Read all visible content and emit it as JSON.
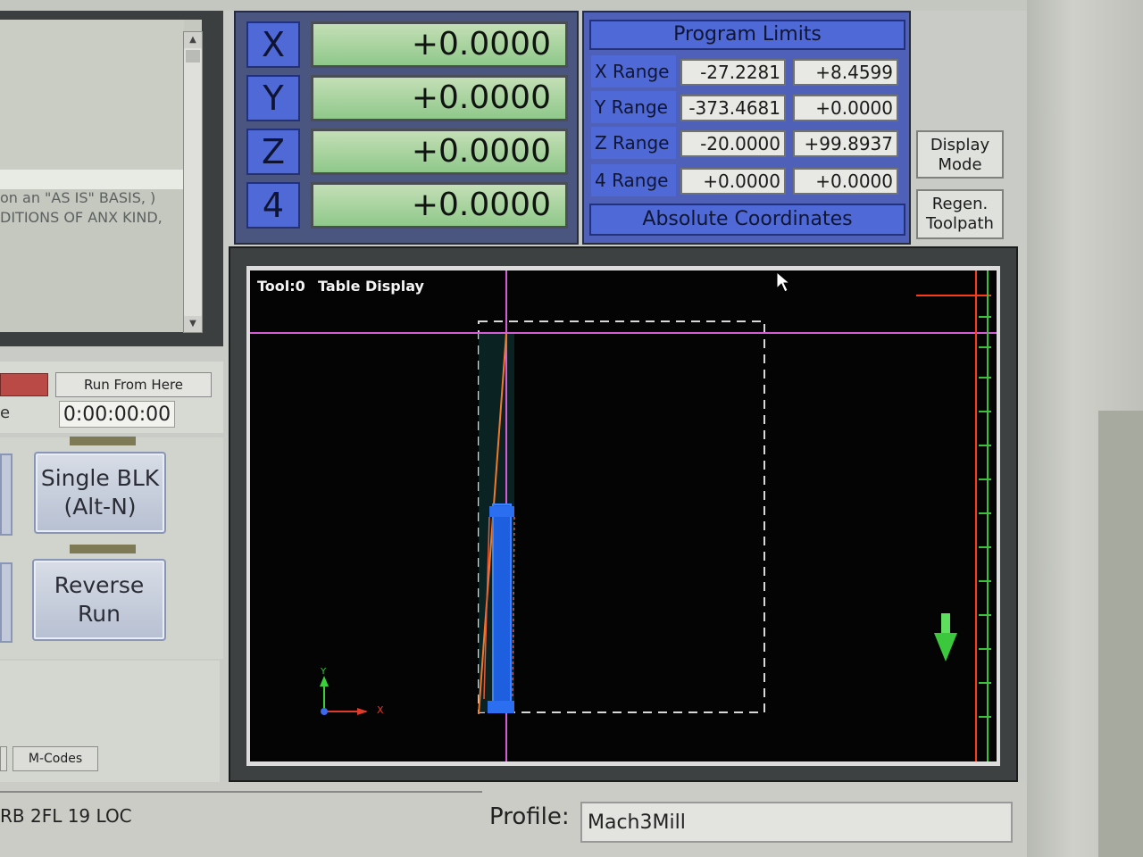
{
  "code_panel": {
    "lines": [
      "on an \"AS IS\" BASIS, )",
      "DITIONS OF ANX KIND,"
    ],
    "scroll_up": "▲",
    "scroll_down": "▼"
  },
  "run_controls": {
    "run_from_here": "Run From Here",
    "time_prefix": "e",
    "elapsed_time": "0:00:00:00",
    "single_block": "Single BLK\n(Alt-N)",
    "reverse_run": "Reverse\nRun",
    "mcodes": "M-Codes"
  },
  "dro": {
    "axes": [
      {
        "label": "X",
        "value": "+0.0000"
      },
      {
        "label": "Y",
        "value": "+0.0000"
      },
      {
        "label": "Z",
        "value": "+0.0000"
      },
      {
        "label": "4",
        "value": "+0.0000"
      }
    ]
  },
  "program_limits": {
    "title": "Program Limits",
    "rows": [
      {
        "label": "X Range",
        "min": "-27.2281",
        "max": "+8.4599"
      },
      {
        "label": "Y Range",
        "min": "-373.4681",
        "max": "+0.0000"
      },
      {
        "label": "Z Range",
        "min": "-20.0000",
        "max": "+99.8937"
      },
      {
        "label": "4 Range",
        "min": "+0.0000",
        "max": "+0.0000"
      }
    ],
    "footer": "Absolute Coordinates"
  },
  "side_buttons": {
    "display_mode": "Display\nMode",
    "regen_toolpath": "Regen.\nToolpath"
  },
  "toolpath": {
    "tool": "Tool:0",
    "title": "Table Display",
    "axis_y": "Y",
    "axis_x": "X"
  },
  "status": {
    "left_text": "RB 2FL 19 LOC",
    "profile_label": "Profile:",
    "profile_value": "Mach3Mill"
  },
  "colors": {
    "dro_axis_blue": "#4f69d6",
    "dro_value_green": "#a8d39c",
    "toolpath_bg": "#040404",
    "led_red": "#b94a45"
  }
}
